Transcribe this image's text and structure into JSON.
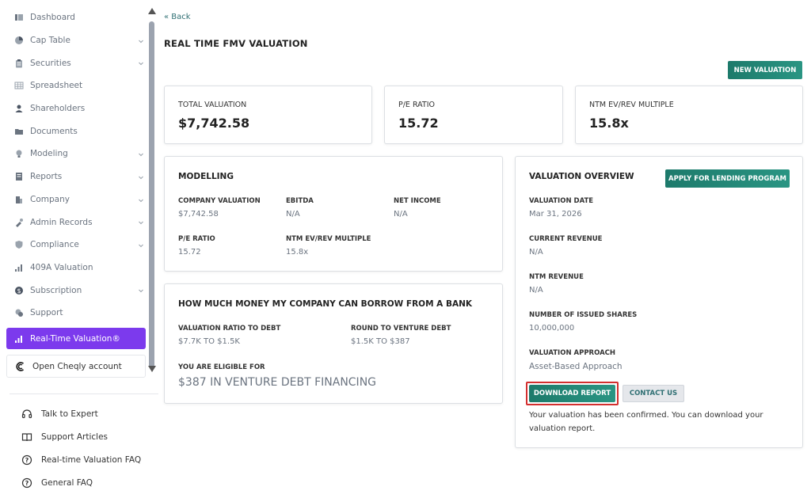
{
  "sidebar": {
    "items": [
      {
        "label": "Dashboard",
        "icon": "dashboard-icon",
        "chevron": false
      },
      {
        "label": "Cap Table",
        "icon": "pie-chart-icon",
        "chevron": true
      },
      {
        "label": "Securities",
        "icon": "clipboard-icon",
        "chevron": true
      },
      {
        "label": "Spreadsheet",
        "icon": "spreadsheet-icon",
        "chevron": false
      },
      {
        "label": "Shareholders",
        "icon": "user-icon",
        "chevron": false
      },
      {
        "label": "Documents",
        "icon": "folder-icon",
        "chevron": false
      },
      {
        "label": "Modeling",
        "icon": "bulb-icon",
        "chevron": true
      },
      {
        "label": "Reports",
        "icon": "report-icon",
        "chevron": true
      },
      {
        "label": "Company",
        "icon": "building-icon",
        "chevron": true
      },
      {
        "label": "Admin Records",
        "icon": "admin-icon",
        "chevron": true
      },
      {
        "label": "Compliance",
        "icon": "shield-icon",
        "chevron": true
      },
      {
        "label": "409A Valuation",
        "icon": "chart-icon",
        "chevron": false
      },
      {
        "label": "Subscription",
        "icon": "dollar-icon",
        "chevron": true
      },
      {
        "label": "Support",
        "icon": "support-icon",
        "chevron": false
      }
    ],
    "active_label": "Real-Time Valuation®",
    "cheqly_label": "Open Cheqly account",
    "help": [
      {
        "label": "Talk to Expert",
        "icon": "headset-icon"
      },
      {
        "label": "Support Articles",
        "icon": "book-icon"
      },
      {
        "label": "Real-time Valuation FAQ",
        "icon": "question-icon"
      },
      {
        "label": "General FAQ",
        "icon": "question-icon"
      }
    ]
  },
  "header": {
    "back_label": "« Back",
    "title": "REAL TIME FMV VALUATION",
    "new_valuation_label": "NEW VALUATION"
  },
  "stats": {
    "total_label": "TOTAL VALUATION",
    "total_value": "$7,742.58",
    "pe_label": "P/E RATIO",
    "pe_value": "15.72",
    "ntm_label": "NTM EV/REV MULTIPLE",
    "ntm_value": "15.8x"
  },
  "modelling": {
    "title": "MODELLING",
    "company_valuation_label": "COMPANY VALUATION",
    "company_valuation_value": "$7,742.58",
    "ebitda_label": "EBITDA",
    "ebitda_value": "N/A",
    "net_income_label": "NET INCOME",
    "net_income_value": "N/A",
    "pe_label": "P/E RATIO",
    "pe_value": "15.72",
    "ntm_label": "NTM EV/REV MULTIPLE",
    "ntm_value": "15.8x"
  },
  "borrow": {
    "title": "HOW MUCH MONEY MY COMPANY CAN BORROW FROM A BANK",
    "ratio_label": "VALUATION RATIO TO DEBT",
    "ratio_value": "$7.7K TO $1.5K",
    "round_label": "ROUND TO VENTURE DEBT",
    "round_value": "$1.5K TO $387",
    "eligible_label": "YOU ARE ELIGIBLE FOR",
    "eligible_value": "$387 IN VENTURE DEBT FINANCING"
  },
  "overview": {
    "title": "VALUATION OVERVIEW",
    "apply_label": "APPLY FOR LENDING PROGRAM",
    "date_label": "VALUATION DATE",
    "date_value": "Mar 31, 2026",
    "revenue_label": "CURRENT REVENUE",
    "revenue_value": "N/A",
    "ntm_revenue_label": "NTM REVENUE",
    "ntm_revenue_value": "N/A",
    "shares_label": "NUMBER OF ISSUED SHARES",
    "shares_value": "10,000,000",
    "approach_label": "VALUATION APPROACH",
    "approach_value": "Asset-Based Approach",
    "download_label": "DOWNLOAD REPORT",
    "contact_label": "CONTACT US",
    "note": "Your valuation has been confirmed. You can download your valuation report."
  },
  "colors": {
    "accent_purple": "#7c3aed",
    "primary_green": "#1d7a6b",
    "highlight_red": "#d32f2f"
  }
}
